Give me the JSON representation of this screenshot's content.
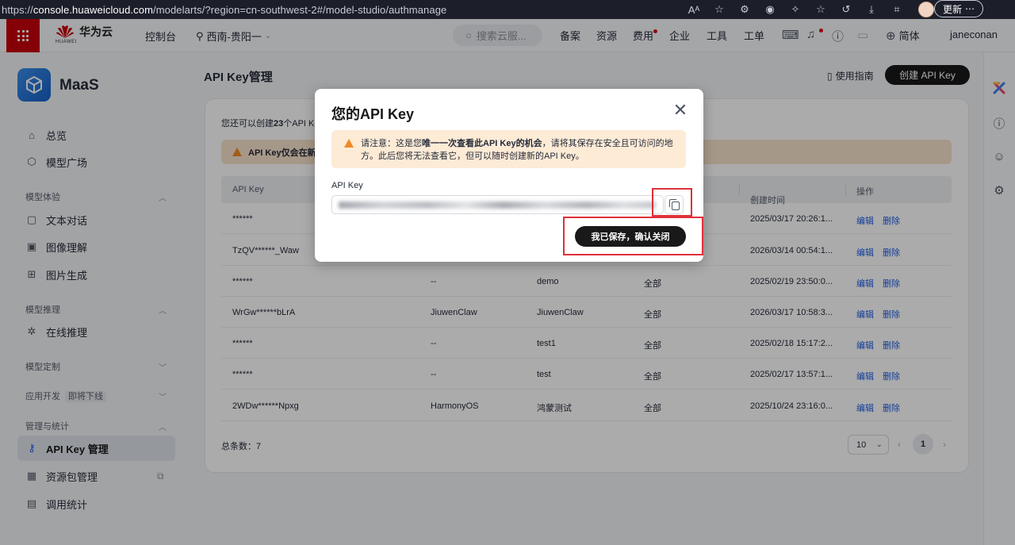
{
  "browser": {
    "url_prefix": "https://",
    "url_host": "console.huaweicloud.com",
    "url_path": "/modelarts/?region=cn-southwest-2#/model-studio/authmanage",
    "update_label": "更新",
    "more_label": "⋯"
  },
  "topnav": {
    "brand_name": "华为云",
    "brand_sub": "HUAWEI",
    "console_label": "控制台",
    "region_label": "西南-贵阳一",
    "search_placeholder": "搜索云服...",
    "links": [
      "备案",
      "资源",
      "费用",
      "企业",
      "工具",
      "工单"
    ],
    "language_label": "简体",
    "username": "janeconan"
  },
  "sidebar": {
    "app_name": "MaaS",
    "items_top": [
      {
        "label": "总览",
        "icon": "home-icon"
      },
      {
        "label": "模型广场",
        "icon": "cube-icon"
      }
    ],
    "sections": [
      {
        "title": "模型体验",
        "expanded": true,
        "items": [
          {
            "label": "文本对话",
            "icon": "chat-icon"
          },
          {
            "label": "图像理解",
            "icon": "image-icon"
          },
          {
            "label": "图片生成",
            "icon": "image-plus-icon"
          }
        ]
      },
      {
        "title": "模型推理",
        "expanded": true,
        "items": [
          {
            "label": "在线推理",
            "icon": "settings-icon"
          }
        ]
      },
      {
        "title": "模型定制",
        "expanded": false,
        "items": []
      },
      {
        "title": "应用开发",
        "tag": "即将下线",
        "expanded": false,
        "items": []
      },
      {
        "title": "管理与统计",
        "expanded": true,
        "items": [
          {
            "label": "API Key 管理",
            "icon": "key-icon",
            "active": true
          },
          {
            "label": "资源包管理",
            "icon": "package-icon",
            "external": true
          },
          {
            "label": "调用统计",
            "icon": "chart-icon"
          }
        ]
      }
    ]
  },
  "main": {
    "title": "API Key管理",
    "guide_label": "使用指南",
    "create_label": "创建 API Key",
    "remain_prefix": "您还可以创建",
    "remain_count": "23",
    "remain_suffix": "个API Ke",
    "warn_text": "API Key仅会在新",
    "columns": [
      "API Key",
      "创建时间",
      "操作"
    ],
    "rows": [
      {
        "key": "******",
        "desc": "",
        "name": "",
        "scope": "",
        "time": "2025/03/17 20:26:1...",
        "edit": "编辑",
        "delete": "删除"
      },
      {
        "key": "TzQV******_Waw",
        "desc": "",
        "name": "",
        "scope": "",
        "time": "2026/03/14 00:54:1...",
        "edit": "编辑",
        "delete": "删除"
      },
      {
        "key": "******",
        "desc": "--",
        "name": "demo",
        "scope": "全部",
        "time": "2025/02/19 23:50:0...",
        "edit": "编辑",
        "delete": "删除"
      },
      {
        "key": "WrGw******bLrA",
        "desc": "JiuwenClaw",
        "name": "JiuwenClaw",
        "scope": "全部",
        "time": "2026/03/17 10:58:3...",
        "edit": "编辑",
        "delete": "删除"
      },
      {
        "key": "******",
        "desc": "--",
        "name": "test1",
        "scope": "全部",
        "time": "2025/02/18 15:17:2...",
        "edit": "编辑",
        "delete": "删除"
      },
      {
        "key": "******",
        "desc": "--",
        "name": "test",
        "scope": "全部",
        "time": "2025/02/17 13:57:1...",
        "edit": "编辑",
        "delete": "删除"
      },
      {
        "key": "2WDw******Npxg",
        "desc": "HarmonyOS",
        "name": "鸿蒙测试",
        "scope": "全部",
        "time": "2025/10/24 23:16:0...",
        "edit": "编辑",
        "delete": "删除"
      }
    ],
    "total_label": "总条数：7",
    "page_size": "10",
    "current_page": "1"
  },
  "modal": {
    "title": "您的API Key",
    "warn_prefix": "请注意：这是您",
    "warn_bold": "唯一一次查看此API Key的机会",
    "warn_suffix": "，请将其保存在安全且可访问的地方。此后您将无法查看它，但可以随时创建新的API Key。",
    "key_label": "API Key",
    "confirm_label": "我已保存，确认关闭"
  },
  "colors": {
    "brand_red": "#c7000b",
    "link_blue": "#1d5ce6",
    "warn_orange": "#f08a24",
    "highlight_red": "#e0303a",
    "button_black": "#191919"
  }
}
